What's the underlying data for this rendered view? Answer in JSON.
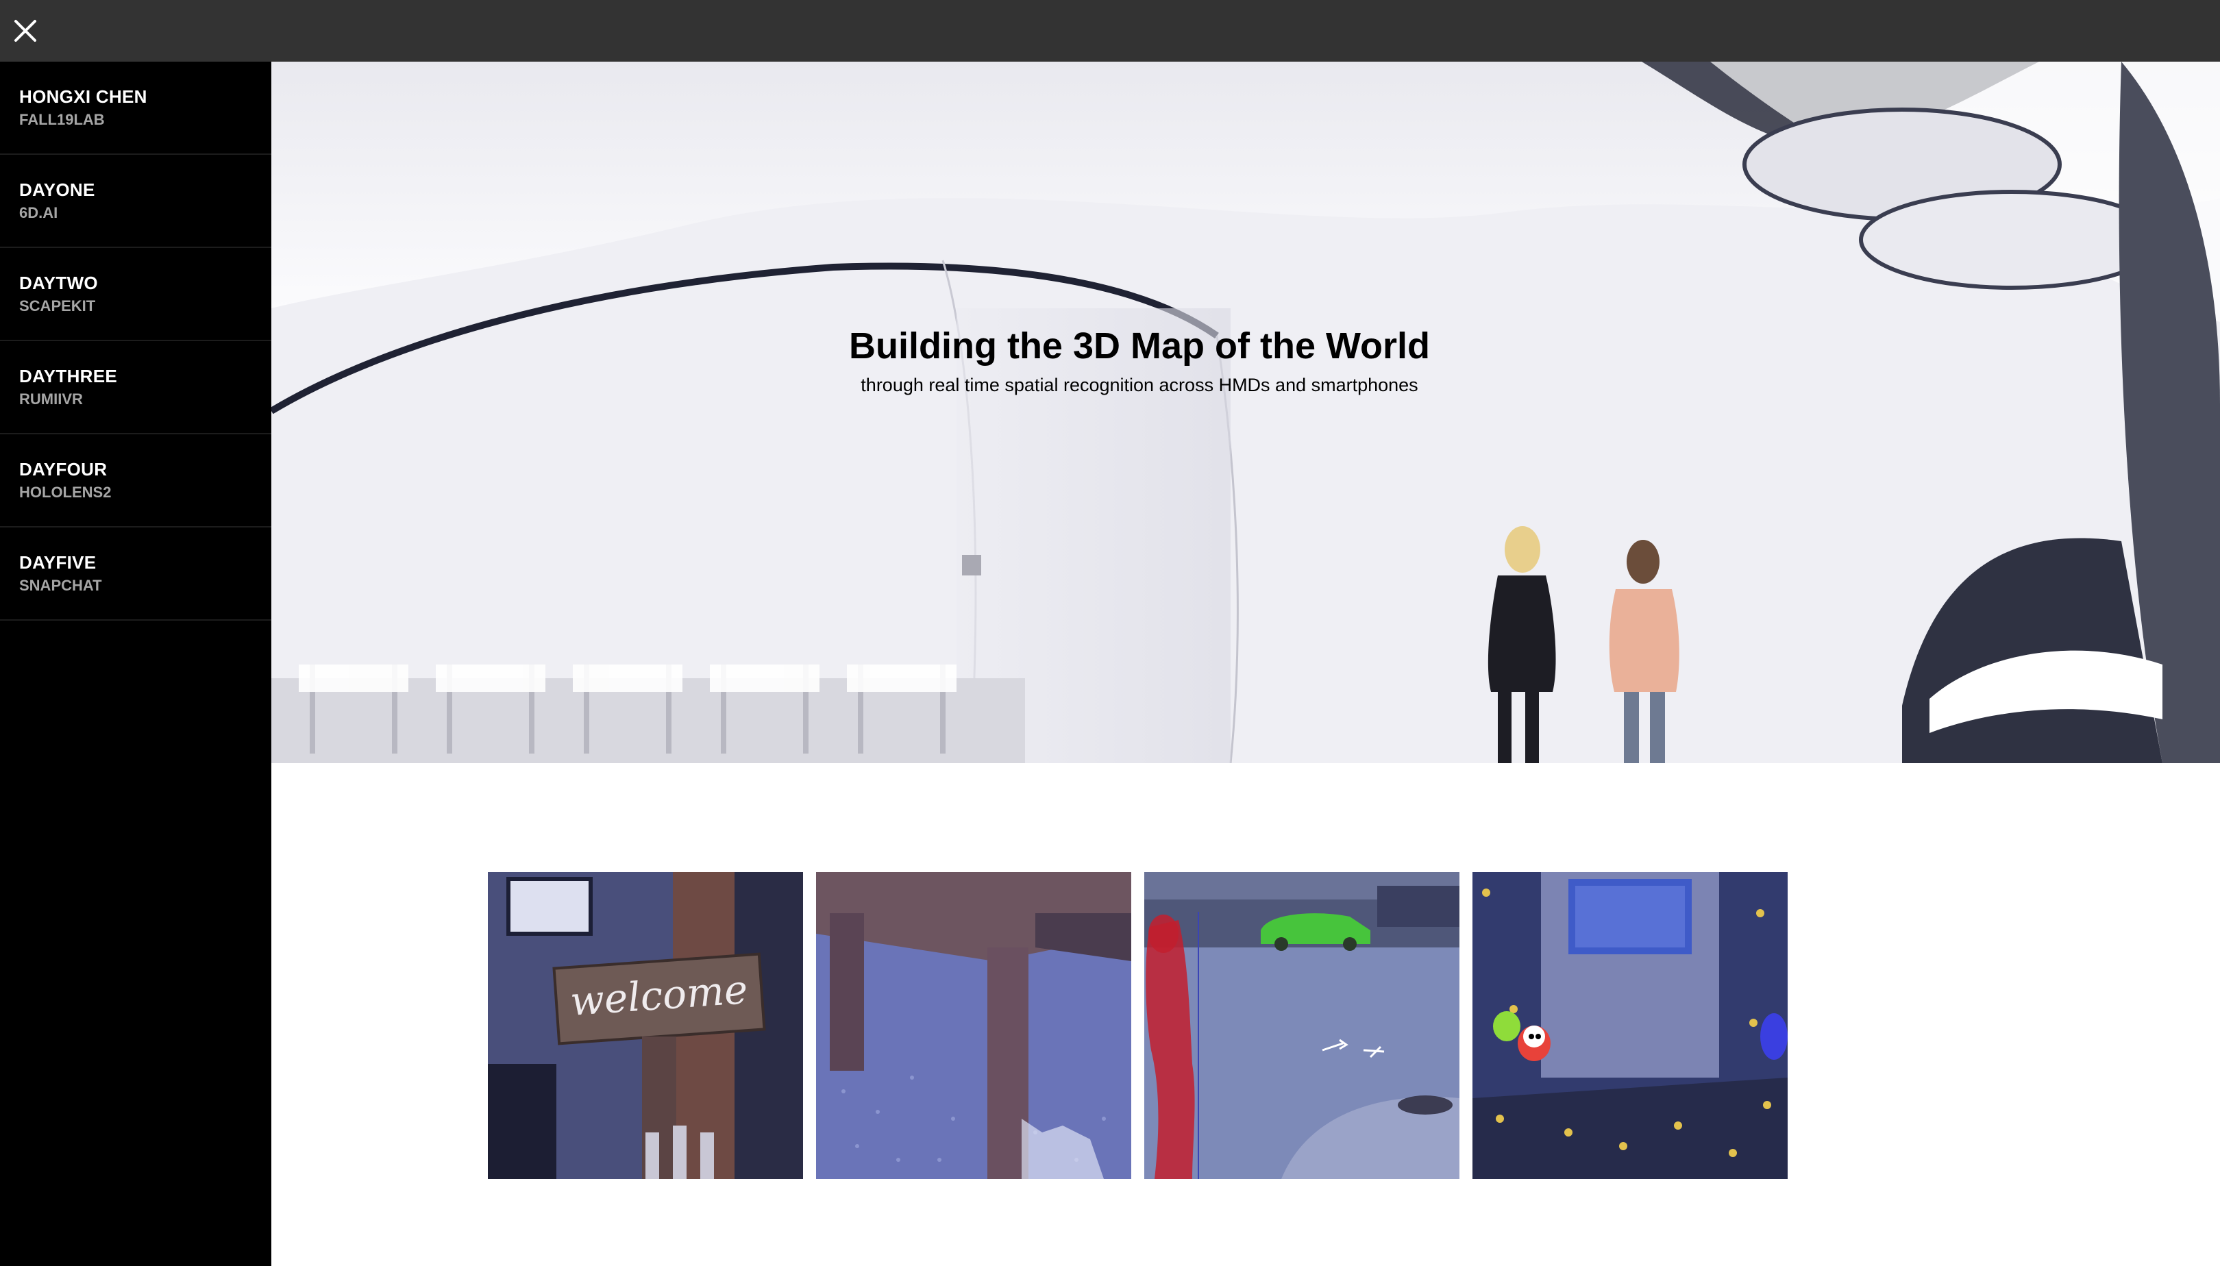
{
  "topbar": {
    "close_icon": "close-icon"
  },
  "sidebar": {
    "items": [
      {
        "title": "HONGXI CHEN",
        "subtitle": "FALL19LAB"
      },
      {
        "title": "DAYONE",
        "subtitle": "6D.AI"
      },
      {
        "title": "DAYTWO",
        "subtitle": "SCAPEKIT"
      },
      {
        "title": "DAYTHREE",
        "subtitle": "RUMIIVR"
      },
      {
        "title": "DAYFOUR",
        "subtitle": "HOLOLENS2"
      },
      {
        "title": "DAYFIVE",
        "subtitle": "SNAPCHAT"
      }
    ]
  },
  "hero": {
    "title": "Building the 3D Map of the World",
    "subtitle": "through real time spatial recognition across HMDs and smartphones"
  },
  "gallery": {
    "images": [
      {
        "sign_text": "welcome"
      },
      {
        "sign_text": ""
      },
      {
        "sign_text": ""
      },
      {
        "sign_text": ""
      }
    ]
  },
  "colors": {
    "topbar": "#333333",
    "sidebar": "#000000",
    "sidebar_title": "#ffffff",
    "sidebar_subtitle": "#a6a6a6",
    "segmentation_red": "#c21e2e",
    "segmentation_green": "#3fbf3a"
  }
}
